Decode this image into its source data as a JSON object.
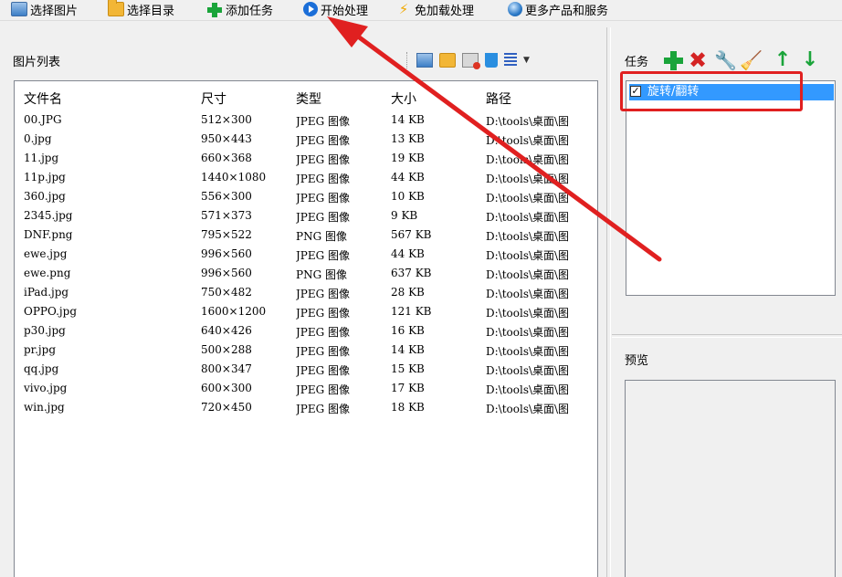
{
  "toolbar": {
    "items": [
      {
        "label": "选择图片",
        "icon": "picture-icon"
      },
      {
        "label": "选择目录",
        "icon": "folder-icon"
      },
      {
        "label": "添加任务",
        "icon": "add-icon"
      },
      {
        "label": "开始处理",
        "icon": "play-icon"
      },
      {
        "label": "免加载处理",
        "icon": "lightning-icon"
      },
      {
        "label": "更多产品和服务",
        "icon": "globe-icon"
      }
    ]
  },
  "image_list": {
    "title": "图片列表",
    "columns": [
      "文件名",
      "尺寸",
      "类型",
      "大小",
      "路径"
    ],
    "rows": [
      [
        "00.JPG",
        "512×300",
        "JPEG 图像",
        "14 KB",
        "D:\\tools\\桌面\\图"
      ],
      [
        "0.jpg",
        "950×443",
        "JPEG 图像",
        "13 KB",
        "D:\\tools\\桌面\\图"
      ],
      [
        "11.jpg",
        "660×368",
        "JPEG 图像",
        "19 KB",
        "D:\\tools\\桌面\\图"
      ],
      [
        "11p.jpg",
        "1440×1080",
        "JPEG 图像",
        "44 KB",
        "D:\\tools\\桌面\\图"
      ],
      [
        "360.jpg",
        "556×300",
        "JPEG 图像",
        "10 KB",
        "D:\\tools\\桌面\\图"
      ],
      [
        "2345.jpg",
        "571×373",
        "JPEG 图像",
        "9 KB",
        "D:\\tools\\桌面\\图"
      ],
      [
        "DNF.png",
        "795×522",
        "PNG 图像",
        "567 KB",
        "D:\\tools\\桌面\\图"
      ],
      [
        "ewe.jpg",
        "996×560",
        "JPEG 图像",
        "44 KB",
        "D:\\tools\\桌面\\图"
      ],
      [
        "ewe.png",
        "996×560",
        "PNG 图像",
        "637 KB",
        "D:\\tools\\桌面\\图"
      ],
      [
        "iPad.jpg",
        "750×482",
        "JPEG 图像",
        "28 KB",
        "D:\\tools\\桌面\\图"
      ],
      [
        "OPPO.jpg",
        "1600×1200",
        "JPEG 图像",
        "121 KB",
        "D:\\tools\\桌面\\图"
      ],
      [
        "p30.jpg",
        "640×426",
        "JPEG 图像",
        "16 KB",
        "D:\\tools\\桌面\\图"
      ],
      [
        "pr.jpg",
        "500×288",
        "JPEG 图像",
        "14 KB",
        "D:\\tools\\桌面\\图"
      ],
      [
        "qq.jpg",
        "800×347",
        "JPEG 图像",
        "15 KB",
        "D:\\tools\\桌面\\图"
      ],
      [
        "vivo.jpg",
        "600×300",
        "JPEG 图像",
        "17 KB",
        "D:\\tools\\桌面\\图"
      ],
      [
        "win.jpg",
        "720×450",
        "JPEG 图像",
        "18 KB",
        "D:\\tools\\桌面\\图"
      ]
    ]
  },
  "task_panel": {
    "title": "任务",
    "tasks": [
      {
        "label": "旋转/翻转",
        "checked": true,
        "selected": true
      }
    ]
  },
  "preview": {
    "title": "预览"
  },
  "colors": {
    "selection": "#3399ff",
    "annotation": "#e02020",
    "add": "#1aa43a"
  }
}
